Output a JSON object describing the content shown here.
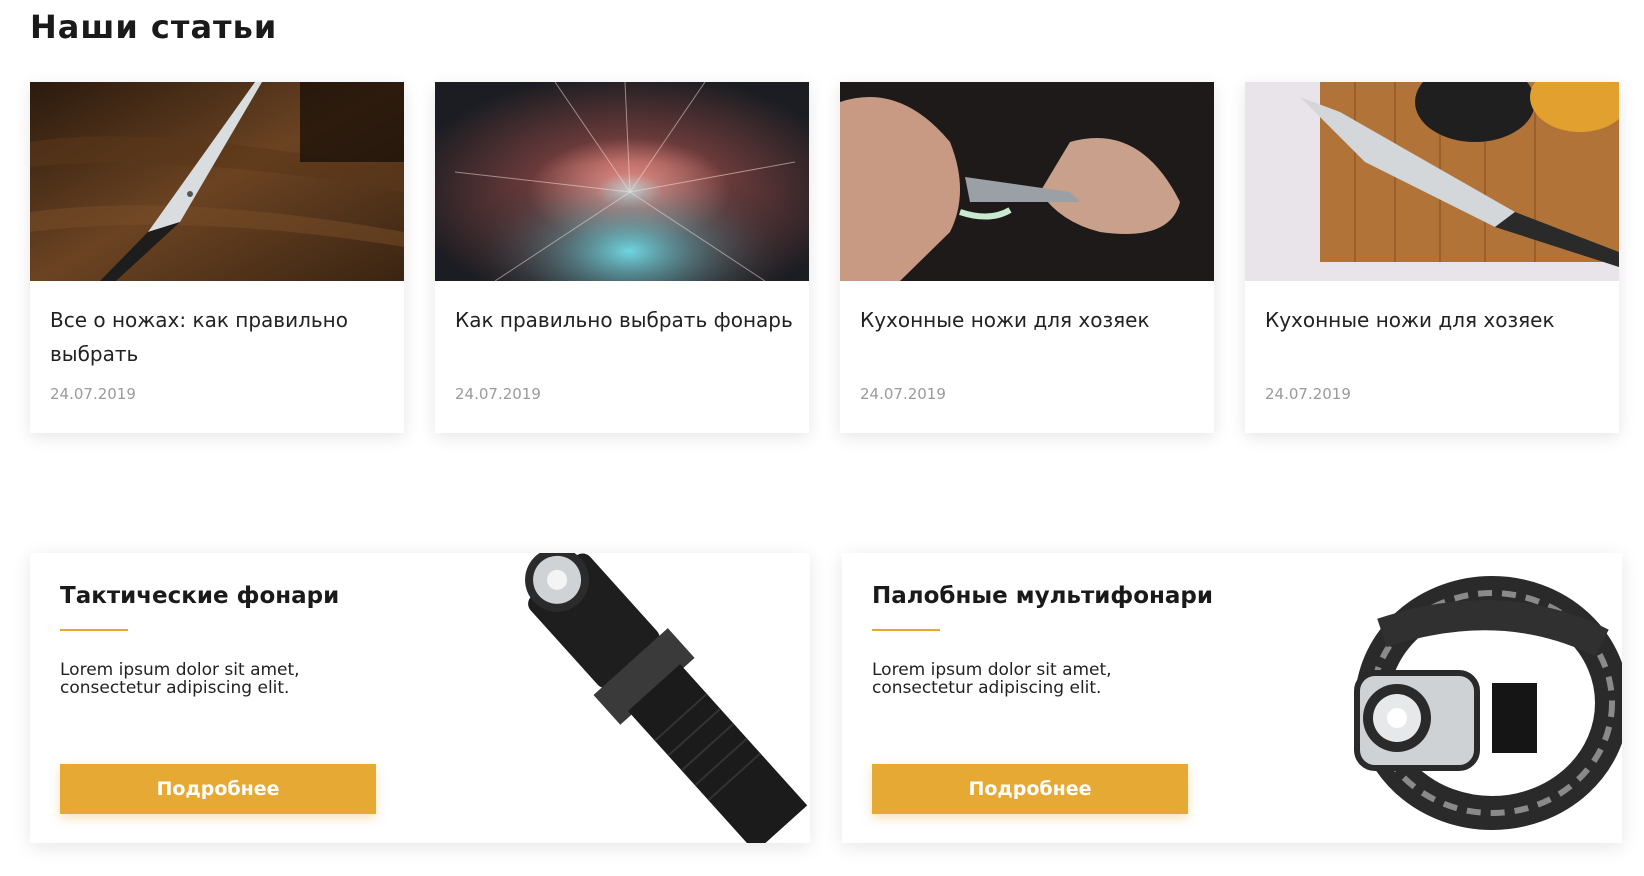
{
  "section": {
    "title": "Наши статьи"
  },
  "articles": [
    {
      "title": "Все о ножах: как правильно выбрать",
      "date": "24.07.2019",
      "image": "knife-on-wood-photo"
    },
    {
      "title": "Как правильно выбрать фонарь",
      "date": "24.07.2019",
      "image": "light-burst-photo"
    },
    {
      "title": "Кухонные ножи для хозяек",
      "date": "24.07.2019",
      "image": "hands-sharpening-knife-photo"
    },
    {
      "title": "Кухонные ножи для хозяек",
      "date": "24.07.2019",
      "image": "chef-knife-cutting-board-photo"
    }
  ],
  "promos": [
    {
      "title": "Тактические фонари",
      "text": "Lorem ipsum dolor sit amet, consectetur adipiscing elit.",
      "button": "Подробнее",
      "image": "tactical-flashlight-image"
    },
    {
      "title": "Палобные мультифонари",
      "text": "Lorem ipsum dolor sit amet, consectetur adipiscing elit.",
      "button": "Подробнее",
      "image": "headlamp-image"
    }
  ],
  "colors": {
    "accent": "#e6a933",
    "date": "#9a9a9a",
    "title": "#1a1a1a"
  }
}
